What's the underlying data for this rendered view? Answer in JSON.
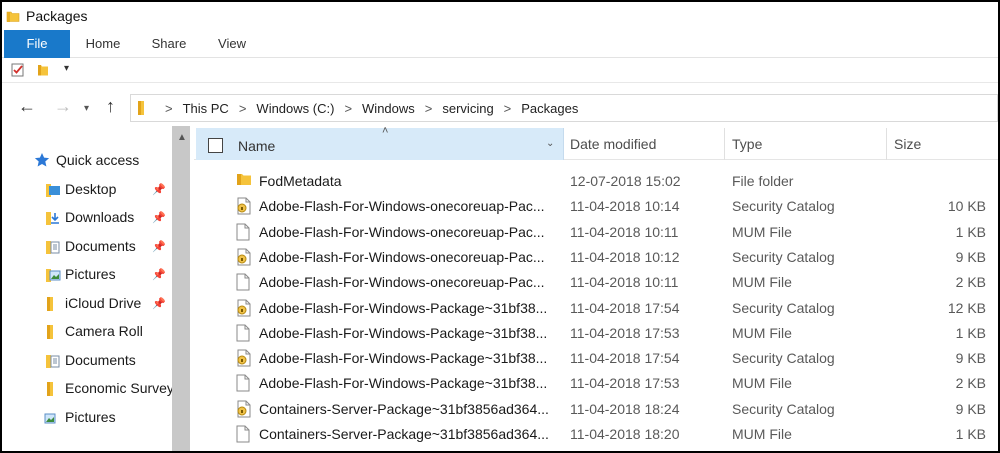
{
  "window": {
    "title": "Packages"
  },
  "ribbon": {
    "tabs": [
      "File",
      "Home",
      "Share",
      "View"
    ]
  },
  "address": {
    "crumbs": [
      "This PC",
      "Windows (C:)",
      "Windows",
      "servicing",
      "Packages"
    ]
  },
  "nav": {
    "items": [
      {
        "label": "Quick access",
        "icon": "star-icon",
        "pinned": false
      },
      {
        "label": "Desktop",
        "icon": "desktop-folder-icon",
        "pinned": true
      },
      {
        "label": "Downloads",
        "icon": "downloads-folder-icon",
        "pinned": true
      },
      {
        "label": "Documents",
        "icon": "documents-folder-icon",
        "pinned": true
      },
      {
        "label": "Pictures",
        "icon": "pictures-folder-icon",
        "pinned": true
      },
      {
        "label": "iCloud Drive",
        "icon": "folder-icon",
        "pinned": true
      },
      {
        "label": "Camera Roll",
        "icon": "folder-icon",
        "pinned": false
      },
      {
        "label": "Documents",
        "icon": "documents-folder-icon",
        "pinned": false
      },
      {
        "label": "Economic Survey",
        "icon": "folder-icon",
        "pinned": false
      },
      {
        "label": "Pictures",
        "icon": "pictures-folder-icon",
        "pinned": false
      }
    ]
  },
  "columns": {
    "name": "Name",
    "date": "Date modified",
    "type": "Type",
    "size": "Size"
  },
  "files": [
    {
      "name": "FodMetadata",
      "date": "12-07-2018 15:02",
      "type": "File folder",
      "size": "",
      "icon": "folder-icon"
    },
    {
      "name": "Adobe-Flash-For-Windows-onecoreuap-Pac...",
      "date": "11-04-2018 10:14",
      "type": "Security Catalog",
      "size": "10 KB",
      "icon": "catalog-icon"
    },
    {
      "name": "Adobe-Flash-For-Windows-onecoreuap-Pac...",
      "date": "11-04-2018 10:11",
      "type": "MUM File",
      "size": "1 KB",
      "icon": "file-icon"
    },
    {
      "name": "Adobe-Flash-For-Windows-onecoreuap-Pac...",
      "date": "11-04-2018 10:12",
      "type": "Security Catalog",
      "size": "9 KB",
      "icon": "catalog-icon"
    },
    {
      "name": "Adobe-Flash-For-Windows-onecoreuap-Pac...",
      "date": "11-04-2018 10:11",
      "type": "MUM File",
      "size": "2 KB",
      "icon": "file-icon"
    },
    {
      "name": "Adobe-Flash-For-Windows-Package~31bf38...",
      "date": "11-04-2018 17:54",
      "type": "Security Catalog",
      "size": "12 KB",
      "icon": "catalog-icon"
    },
    {
      "name": "Adobe-Flash-For-Windows-Package~31bf38...",
      "date": "11-04-2018 17:53",
      "type": "MUM File",
      "size": "1 KB",
      "icon": "file-icon"
    },
    {
      "name": "Adobe-Flash-For-Windows-Package~31bf38...",
      "date": "11-04-2018 17:54",
      "type": "Security Catalog",
      "size": "9 KB",
      "icon": "catalog-icon"
    },
    {
      "name": "Adobe-Flash-For-Windows-Package~31bf38...",
      "date": "11-04-2018 17:53",
      "type": "MUM File",
      "size": "2 KB",
      "icon": "file-icon"
    },
    {
      "name": "Containers-Server-Package~31bf3856ad364...",
      "date": "11-04-2018 18:24",
      "type": "Security Catalog",
      "size": "9 KB",
      "icon": "catalog-icon"
    },
    {
      "name": "Containers-Server-Package~31bf3856ad364...",
      "date": "11-04-2018 18:20",
      "type": "MUM File",
      "size": "1 KB",
      "icon": "file-icon"
    }
  ],
  "colors": {
    "accent": "#1979ca",
    "header_selected": "#d7eaf9",
    "folder": "#f5c33b"
  }
}
